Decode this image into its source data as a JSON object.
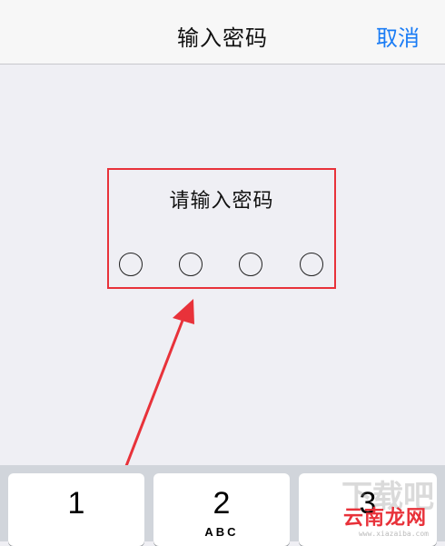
{
  "nav": {
    "title": "输入密码",
    "cancel_label": "取消"
  },
  "passcode": {
    "prompt": "请输入密码",
    "digits_total": 4,
    "digits_entered": 0
  },
  "keypad": {
    "keys": [
      {
        "number": "1",
        "letters": ""
      },
      {
        "number": "2",
        "letters": "ABC"
      },
      {
        "number": "3",
        "letters": ""
      }
    ]
  },
  "watermark": {
    "faint_text": "下载吧",
    "main_text": "云南龙网",
    "url": "www.xiazaiba.com"
  },
  "colors": {
    "accent": "#1a7cf5",
    "annotation": "#e8323a",
    "background": "#efeff4",
    "nav_background": "#f7f7f7",
    "keypad_background": "#d1d5db"
  }
}
